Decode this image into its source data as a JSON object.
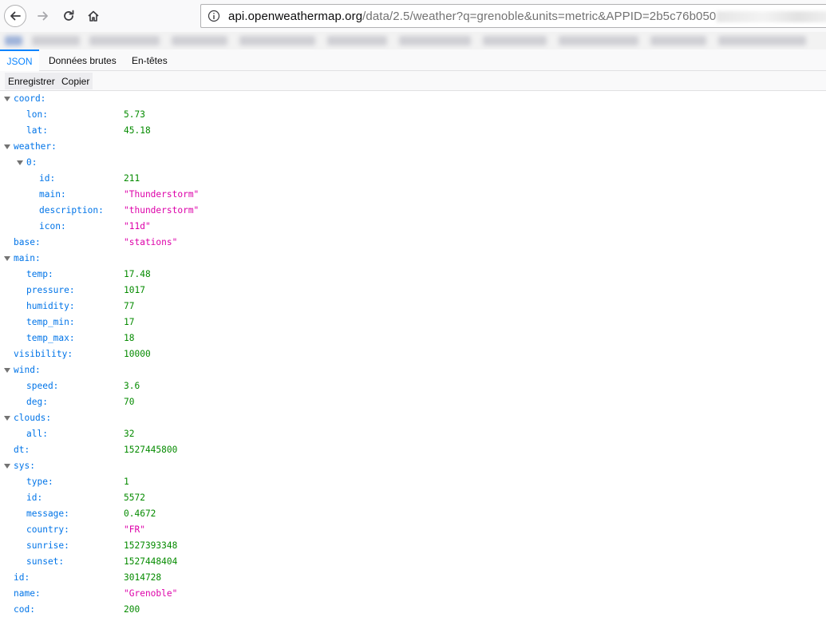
{
  "browser": {
    "url_host": "api.openweathermap.org",
    "url_path_visible": "/data/2.5/weather?q=grenoble&units=metric&APPID=2b5c76b050",
    "url_tail_visible": "lea1cd40d"
  },
  "tabs": [
    {
      "label": "JSON",
      "active": true
    },
    {
      "label": "Données brutes",
      "active": false
    },
    {
      "label": "En-têtes",
      "active": false
    }
  ],
  "toolbar": {
    "save_label": "Enregistrer",
    "copy_label": "Copier"
  },
  "json_tree": [
    {
      "key": "coord:",
      "depth": 0,
      "toggle": true
    },
    {
      "key": "lon:",
      "depth": 1,
      "value": "5.73",
      "type": "num"
    },
    {
      "key": "lat:",
      "depth": 1,
      "value": "45.18",
      "type": "num"
    },
    {
      "key": "weather:",
      "depth": 0,
      "toggle": true
    },
    {
      "key": "0:",
      "depth": 1,
      "toggle": true
    },
    {
      "key": "id:",
      "depth": 2,
      "value": "211",
      "type": "num"
    },
    {
      "key": "main:",
      "depth": 2,
      "value": "\"Thunderstorm\"",
      "type": "str"
    },
    {
      "key": "description:",
      "depth": 2,
      "value": "\"thunderstorm\"",
      "type": "str"
    },
    {
      "key": "icon:",
      "depth": 2,
      "value": "\"11d\"",
      "type": "str"
    },
    {
      "key": "base:",
      "depth": 0,
      "value": "\"stations\"",
      "type": "str"
    },
    {
      "key": "main:",
      "depth": 0,
      "toggle": true
    },
    {
      "key": "temp:",
      "depth": 1,
      "value": "17.48",
      "type": "num"
    },
    {
      "key": "pressure:",
      "depth": 1,
      "value": "1017",
      "type": "num"
    },
    {
      "key": "humidity:",
      "depth": 1,
      "value": "77",
      "type": "num"
    },
    {
      "key": "temp_min:",
      "depth": 1,
      "value": "17",
      "type": "num"
    },
    {
      "key": "temp_max:",
      "depth": 1,
      "value": "18",
      "type": "num"
    },
    {
      "key": "visibility:",
      "depth": 0,
      "value": "10000",
      "type": "num"
    },
    {
      "key": "wind:",
      "depth": 0,
      "toggle": true
    },
    {
      "key": "speed:",
      "depth": 1,
      "value": "3.6",
      "type": "num"
    },
    {
      "key": "deg:",
      "depth": 1,
      "value": "70",
      "type": "num"
    },
    {
      "key": "clouds:",
      "depth": 0,
      "toggle": true
    },
    {
      "key": "all:",
      "depth": 1,
      "value": "32",
      "type": "num"
    },
    {
      "key": "dt:",
      "depth": 0,
      "value": "1527445800",
      "type": "num"
    },
    {
      "key": "sys:",
      "depth": 0,
      "toggle": true
    },
    {
      "key": "type:",
      "depth": 1,
      "value": "1",
      "type": "num"
    },
    {
      "key": "id:",
      "depth": 1,
      "value": "5572",
      "type": "num"
    },
    {
      "key": "message:",
      "depth": 1,
      "value": "0.4672",
      "type": "num"
    },
    {
      "key": "country:",
      "depth": 1,
      "value": "\"FR\"",
      "type": "str"
    },
    {
      "key": "sunrise:",
      "depth": 1,
      "value": "1527393348",
      "type": "num"
    },
    {
      "key": "sunset:",
      "depth": 1,
      "value": "1527448404",
      "type": "num"
    },
    {
      "key": "id:",
      "depth": 0,
      "value": "3014728",
      "type": "num"
    },
    {
      "key": "name:",
      "depth": 0,
      "value": "\"Grenoble\"",
      "type": "str"
    },
    {
      "key": "cod:",
      "depth": 0,
      "value": "200",
      "type": "num"
    }
  ],
  "colors": {
    "key": "#0074e8",
    "number": "#058b00",
    "string": "#dd00a9",
    "active_tab": "#0a84ff"
  }
}
